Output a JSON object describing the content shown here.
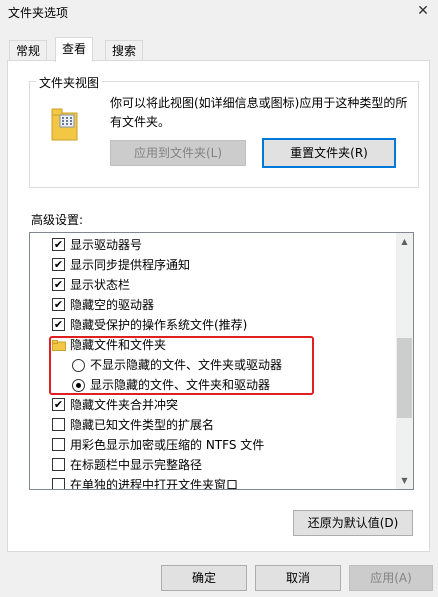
{
  "window": {
    "title": "文件夹选项",
    "close_glyph": "✕"
  },
  "tabs": [
    {
      "label": "常规",
      "active": false
    },
    {
      "label": "查看",
      "active": true
    },
    {
      "label": "搜索",
      "active": false
    }
  ],
  "folder_views": {
    "legend": "文件夹视图",
    "description": "你可以将此视图(如详细信息或图标)应用于这种类型的所有文件夹。",
    "apply_button": "应用到文件夹(L)",
    "reset_button": "重置文件夹(R)"
  },
  "advanced": {
    "label": "高级设置:",
    "items": [
      {
        "type": "checkbox",
        "checked": true,
        "label": "显示驱动器号"
      },
      {
        "type": "checkbox",
        "checked": true,
        "label": "显示同步提供程序通知"
      },
      {
        "type": "checkbox",
        "checked": true,
        "label": "显示状态栏"
      },
      {
        "type": "checkbox",
        "checked": true,
        "label": "隐藏空的驱动器"
      },
      {
        "type": "checkbox",
        "checked": true,
        "label": "隐藏受保护的操作系统文件(推荐)"
      },
      {
        "type": "folder",
        "label": "隐藏文件和文件夹"
      },
      {
        "type": "radio",
        "checked": false,
        "label": "不显示隐藏的文件、文件夹或驱动器"
      },
      {
        "type": "radio",
        "checked": true,
        "label": "显示隐藏的文件、文件夹和驱动器"
      },
      {
        "type": "checkbox",
        "checked": true,
        "label": "隐藏文件夹合并冲突"
      },
      {
        "type": "checkbox",
        "checked": false,
        "label": "隐藏已知文件类型的扩展名"
      },
      {
        "type": "checkbox",
        "checked": false,
        "label": "用彩色显示加密或压缩的 NTFS 文件"
      },
      {
        "type": "checkbox",
        "checked": false,
        "label": "在标题栏中显示完整路径"
      },
      {
        "type": "checkbox",
        "checked": false,
        "label": "在单独的进程中打开文件夹窗口"
      }
    ],
    "restore_defaults_button": "还原为默认值(D)"
  },
  "footer": {
    "ok_button": "确定",
    "cancel_button": "取消",
    "apply_button": "应用(A)"
  },
  "icons": {
    "check_glyph": "✔",
    "scroll_up": "▲",
    "scroll_down": "▼"
  },
  "colors": {
    "highlight_box": "#e02020",
    "focus_border": "#0078d7"
  }
}
